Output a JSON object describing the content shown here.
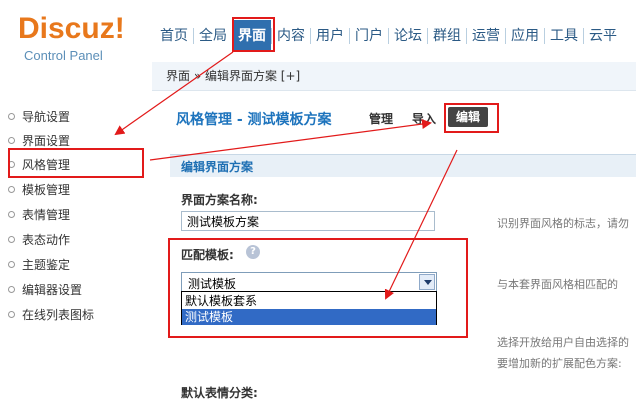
{
  "logo": {
    "brand": "Discuz!",
    "subtitle": "Control Panel"
  },
  "topnav": {
    "items": [
      "首页",
      "全局",
      "界面",
      "内容",
      "用户",
      "门户",
      "论坛",
      "群组",
      "运营",
      "应用",
      "工具",
      "云平"
    ],
    "active_index": 2
  },
  "breadcrumb": "界面 » 编辑界面方案 [+]",
  "sidebar": {
    "items": [
      "导航设置",
      "界面设置",
      "风格管理",
      "模板管理",
      "表情管理",
      "表态动作",
      "主题鉴定",
      "编辑器设置",
      "在线列表图标"
    ],
    "active_index": 2
  },
  "page": {
    "title": "风格管理 - 测试模板方案",
    "tabs": [
      "管理",
      "导入",
      "编辑"
    ],
    "active_tab": 2
  },
  "form": {
    "section_title": "编辑界面方案",
    "name_label": "界面方案名称:",
    "name_value": "测试模板方案",
    "name_hint": "识别界面风格的标志，请勿",
    "match_label": "匹配模板:",
    "help_glyph": "?",
    "match_selected": "测试模板",
    "match_options": [
      "默认模板套系",
      "测试模板"
    ],
    "match_highlighted": 1,
    "match_hint": "与本套界面风格相匹配的",
    "extend_hint_1": "选择开放给用户自由选择的",
    "extend_hint_2": "要增加新的扩展配色方案:",
    "emoji_label": "默认表情分类:"
  },
  "colors": {
    "annotation_red": "#e21a1a",
    "nav_active_bg": "#2f6fae",
    "logo_orange": "#e8781c",
    "title_blue": "#1e74bd"
  }
}
